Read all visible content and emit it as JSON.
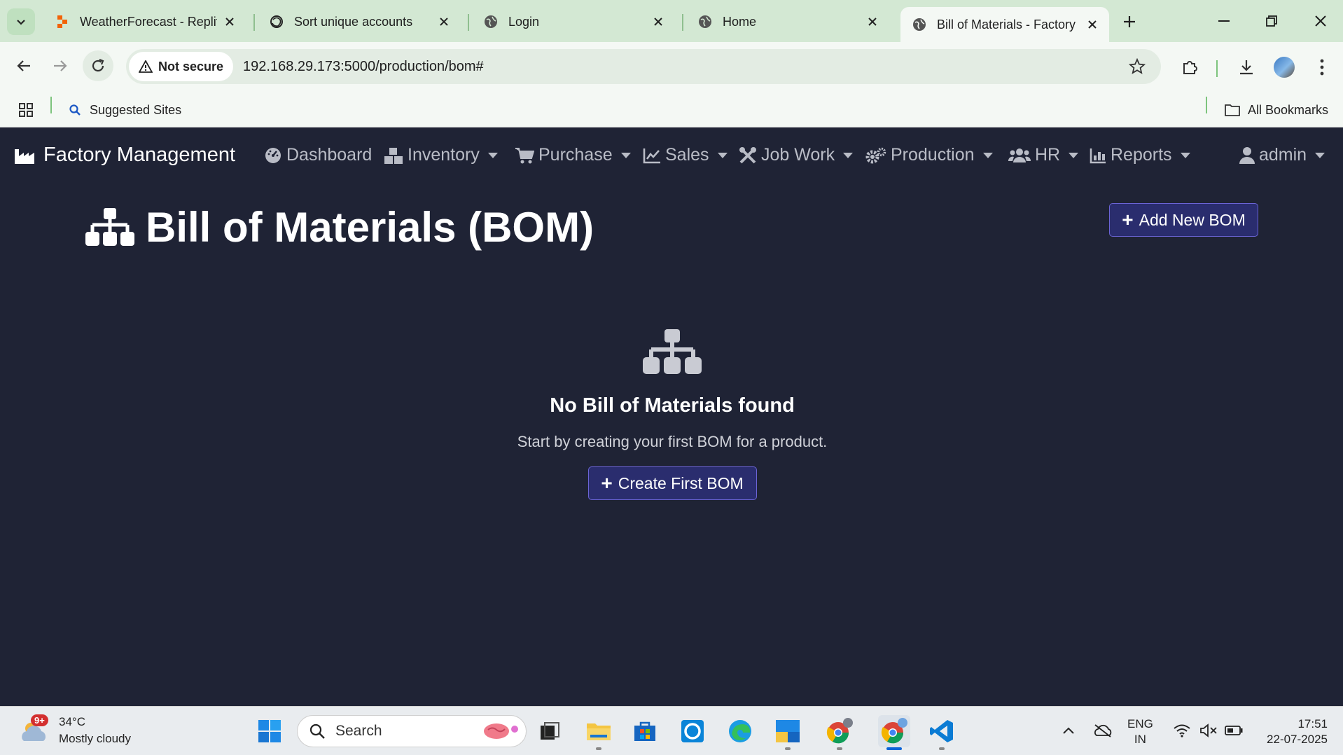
{
  "browser": {
    "tabs": [
      {
        "title": "WeatherForecast - Replit",
        "icon": "replit-icon"
      },
      {
        "title": "Sort unique accounts",
        "icon": "chatgpt-icon"
      },
      {
        "title": "Login",
        "icon": "globe-icon"
      },
      {
        "title": "Home",
        "icon": "globe-icon"
      },
      {
        "title": "Bill of Materials - Factory",
        "icon": "globe-icon",
        "active": true
      }
    ],
    "security_label": "Not secure",
    "url": "192.168.29.173:5000/production/bom#",
    "bookmarks": {
      "suggested": "Suggested Sites",
      "all": "All Bookmarks"
    }
  },
  "app": {
    "brand": "Factory Management",
    "nav": [
      {
        "label": "Dashboard",
        "icon": "dashboard-icon",
        "dropdown": false
      },
      {
        "label": "Inventory",
        "icon": "boxes-icon",
        "dropdown": true
      },
      {
        "label": "Purchase",
        "icon": "cart-icon",
        "dropdown": true
      },
      {
        "label": "Sales",
        "icon": "line-chart-icon",
        "dropdown": true
      },
      {
        "label": "Job Work",
        "icon": "tools-icon",
        "dropdown": true
      },
      {
        "label": "Production",
        "icon": "gears-icon",
        "dropdown": true
      },
      {
        "label": "HR",
        "icon": "users-icon",
        "dropdown": true
      },
      {
        "label": "Reports",
        "icon": "report-chart-icon",
        "dropdown": true
      }
    ],
    "user": "admin"
  },
  "page": {
    "title": "Bill of Materials (BOM)",
    "add_button": "Add New BOM",
    "empty_title": "No Bill of Materials found",
    "empty_text": "Start by creating your first BOM for a product.",
    "create_button": "Create First BOM"
  },
  "taskbar": {
    "weather_temp": "34°C",
    "weather_desc": "Mostly cloudy",
    "weather_badge": "9+",
    "search_placeholder": "Search",
    "lang_line1": "ENG",
    "lang_line2": "IN",
    "time": "17:51",
    "date": "22-07-2025"
  },
  "colors": {
    "page_bg": "#1f2335",
    "button_bg": "#2a2d6e",
    "button_border": "#6b64d6",
    "tabstrip_bg": "#d3e8d3"
  }
}
